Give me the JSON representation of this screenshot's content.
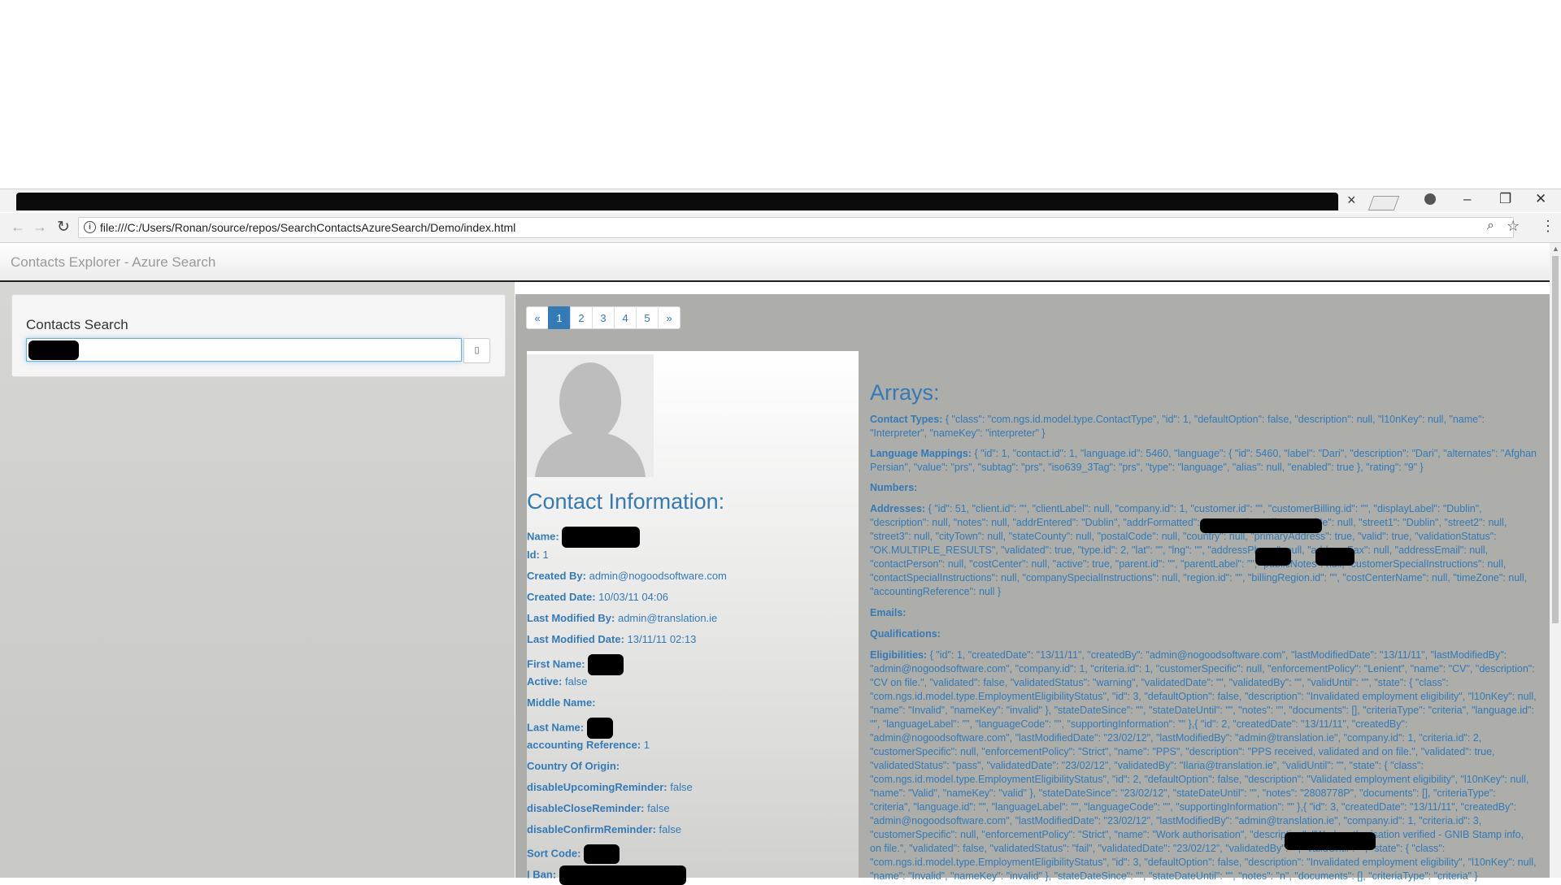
{
  "browser": {
    "url": "file:///C:/Users/Ronan/source/repos/SearchContactsAzureSearch/Demo/index.html",
    "tab_close": "×",
    "win_min": "–",
    "win_max": "❐",
    "win_close": "✕"
  },
  "page": {
    "brand": "Contacts Explorer - Azure Search",
    "search_title": "Contacts Search"
  },
  "pagination": [
    "«",
    "1",
    "2",
    "3",
    "4",
    "5",
    "»"
  ],
  "pagination_active": "1",
  "contact": {
    "heading": "Contact Information:",
    "name_label": "Name:",
    "id_label": "Id:",
    "id_value": "1",
    "created_by_label": "Created By:",
    "created_by_value": "admin@nogoodsoftware.com",
    "created_date_label": "Created Date:",
    "created_date_value": "10/03/11 04:06",
    "last_modified_by_label": "Last Modified By:",
    "last_modified_by_value": "admin@translation.ie",
    "last_modified_date_label": "Last Modified Date:",
    "last_modified_date_value": "13/11/11 02:13",
    "first_name_label": "First Name:",
    "active_label": "Active:",
    "active_value": "false",
    "middle_name_label": "Middle Name:",
    "last_name_label": "Last Name:",
    "accounting_label": "accounting Reference:",
    "accounting_value": "1",
    "country_label": "Country Of Origin:",
    "upcoming_label": "disableUpcomingReminder:",
    "upcoming_value": "false",
    "close_label": "disableCloseReminder:",
    "close_value": "false",
    "confirm_label": "disableConfirmReminder:",
    "confirm_value": "false",
    "sort_code_label": "Sort Code:",
    "iban_label": "I Ban:"
  },
  "arrays": {
    "heading": "Arrays:",
    "contact_types_label": "Contact Types:",
    "contact_types_value": "{ \"class\": \"com.ngs.id.model.type.ContactType\", \"id\": 1, \"defaultOption\": false, \"description\": null, \"l10nKey\": null, \"name\": \"Interpreter\", \"nameKey\": \"interpreter\" }",
    "language_mappings_label": "Language Mappings:",
    "language_mappings_value": "{ \"id\": 1, \"contact.id\": 1, \"language.id\": 5460, \"language\": { \"id\": 5460, \"label\": \"Dari\", \"description\": \"Dari\", \"alternates\": \"Afghan Persian\", \"value\": \"prs\", \"subtag\": \"prs\", \"iso639_3Tag\": \"prs\", \"type\": \"language\", \"alias\": null, \"enabled\": true }, \"rating\": \"9\" }",
    "numbers_label": "Numbers:",
    "addresses_label": "Addresses:",
    "addresses_value": "{ \"id\": 51, \"client.id\": \"\", \"clientLabel\": null, \"company.id\": 1, \"customer.id\": \"\", \"customerBilling.id\": \"\", \"displayLabel\": \"Dublin\", \"description\": null, \"notes\": null, \"addrEntered\": \"Dublin\", \"addrFormatted\": \"\", \"aptUnit\": null, \"preamble\": null, \"street1\": \"Dublin\", \"street2\": null, \"street3\": null, \"cityTown\": null, \"stateCounty\": null, \"postalCode\": null, \"country\": null, \"primaryAddress\": true, \"valid\": true, \"validationStatus\": \"OK.MULTIPLE_RESULTS\", \"validated\": true, \"type.id\": 2, \"lat\": \"\", \"lng\": \"\", \"addressPhone\": null, \"addressFax\": null, \"addressEmail\": null, \"contactPerson\": null, \"costCenter\": null, \"active\": true, \"parent.id\": \"\", \"parentLabel\": \"\", \"publicNotes\": null, \"customerSpecialInstructions\": null, \"contactSpecialInstructions\": null, \"companySpecialInstructions\": null, \"region.id\": \"\", \"billingRegion.id\": \"\", \"costCenterName\": null, \"timeZone\": null, \"accountingReference\": null }",
    "emails_label": "Emails:",
    "qualifications_label": "Qualifications:",
    "eligibilities_label": "Eligibilities:",
    "eligibilities_value": "{ \"id\": 1, \"createdDate\": \"13/11/11\", \"createdBy\": \"admin@nogoodsoftware.com\", \"lastModifiedDate\": \"13/11/11\", \"lastModifiedBy\": \"admin@nogoodsoftware.com\", \"company.id\": 1, \"criteria.id\": 1, \"customerSpecific\": null, \"enforcementPolicy\": \"Lenient\", \"name\": \"CV\", \"description\": \"CV on file.\", \"validated\": false, \"validatedStatus\": \"warning\", \"validatedDate\": \"\", \"validatedBy\": \"\", \"validUntil\": \"\", \"state\": { \"class\": \"com.ngs.id.model.type.EmploymentEligibilityStatus\", \"id\": 3, \"defaultOption\": false, \"description\": \"Invalidated employment eligibility\", \"l10nKey\": null, \"name\": \"Invalid\", \"nameKey\": \"invalid\" }, \"stateDateSince\": \"\", \"stateDateUntil\": \"\", \"notes\": \"\", \"documents\": [], \"criteriaType\": \"criteria\", \"language.id\": \"\", \"languageLabel\": \"\", \"languageCode\": \"\", \"supportingInformation\": \"\" },{ \"id\": 2, \"createdDate\": \"13/11/11\", \"createdBy\": \"admin@nogoodsoftware.com\", \"lastModifiedDate\": \"23/02/12\", \"lastModifiedBy\": \"admin@translation.ie\", \"company.id\": 1, \"criteria.id\": 2, \"customerSpecific\": null, \"enforcementPolicy\": \"Strict\", \"name\": \"PPS\", \"description\": \"PPS received, validated and on file.\", \"validated\": true, \"validatedStatus\": \"pass\", \"validatedDate\": \"23/02/12\", \"validatedBy\": \"Ilaria@translation.ie\", \"validUntil\": \"\", \"state\": { \"class\": \"com.ngs.id.model.type.EmploymentEligibilityStatus\", \"id\": 2, \"defaultOption\": false, \"description\": \"Validated employment eligibility\", \"l10nKey\": null, \"name\": \"Valid\", \"nameKey\": \"valid\" }, \"stateDateSince\": \"23/02/12\", \"stateDateUntil\": \"\", \"notes\": \"2808778P\", \"documents\": [], \"criteriaType\": \"criteria\", \"language.id\": \"\", \"languageLabel\": \"\", \"languageCode\": \"\", \"supportingInformation\": \"\" },{ \"id\": 3, \"createdDate\": \"13/11/11\", \"createdBy\": \"admin@nogoodsoftware.com\", \"lastModifiedDate\": \"23/02/12\", \"lastModifiedBy\": \"admin@translation.ie\", \"company.id\": 1, \"criteria.id\": 3, \"customerSpecific\": null, \"enforcementPolicy\": \"Strict\", \"name\": \"Work authorisation\", \"description\": \"Work authorisation verified - GNIB Stamp info, on file.\", \"validated\": false, \"validatedStatus\": \"fail\", \"validatedDate\": \"23/02/12\", \"validatedBy\": \"\", \"validUntil\": \"\", \"state\": { \"class\": \"com.ngs.id.model.type.EmploymentEligibilityStatus\", \"id\": 3, \"defaultOption\": false, \"description\": \"Invalidated employment eligibility\", \"l10nKey\": null, \"name\": \"Invalid\", \"nameKey\": \"invalid\" }, \"stateDateSince\": \"\", \"stateDateUntil\": \"\", \"notes\": \"n\", \"documents\": [], \"criteriaType\": \"criteria\" }"
  },
  "colors": {
    "link_blue": "#337ab7",
    "results_bg": "#adadaa",
    "redaction": "#000000"
  }
}
